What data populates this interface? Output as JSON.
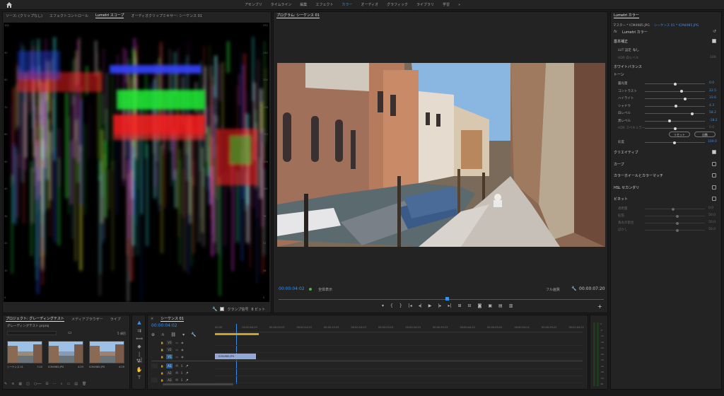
{
  "workspaces": {
    "items": [
      "アセンブリ",
      "タイムライン",
      "編集",
      "エフェクト",
      "カラー",
      "オーディオ",
      "グラフィック",
      "ライブラリ",
      "学習"
    ],
    "active_index": 4,
    "more": "»"
  },
  "scope_panel": {
    "tabs": [
      "ソース: (クリップなし)",
      "エフェクトコントロール",
      "Lumetri スコープ",
      "オーディオクリップミキサー: シーケンス 01"
    ],
    "active_tab": 2,
    "left_ticks": [
      "100",
      "90",
      "80",
      "70",
      "60",
      "50",
      "40",
      "30",
      "20",
      "10",
      "0"
    ],
    "right_ticks": [
      "255",
      "230",
      "204",
      "178",
      "153",
      "128",
      "102",
      "76",
      "51",
      "26",
      "0"
    ],
    "clamp_label": "クランプ信号",
    "bit_label": "8 ビット"
  },
  "program_panel": {
    "title": "プログラム: シーケンス 01",
    "timecode": "00:00:04:02",
    "fit_label": "全体表示",
    "quality_label": "フル画質",
    "duration": "00:00:07:20"
  },
  "lumetri": {
    "title": "Lumetri カラー",
    "master_label": "マスター * ICM4985.JPG",
    "sequence_label": "シーケンス 01 * ICM4985.JPG",
    "fx_label": "Lumetri カラー",
    "basic": "基本補正",
    "lut_label": "LUT 設定",
    "lut_value": "なし",
    "hdr_label": "HDR 白レベル",
    "hdr_value": "100",
    "white_balance": "ホワイトバランス",
    "tone": "トーン",
    "sliders": [
      {
        "label": "露光量",
        "value": "0.0",
        "pos": 0.5
      },
      {
        "label": "コントラスト",
        "value": "22.5",
        "pos": 0.61
      },
      {
        "label": "ハイライト",
        "value": "33.6",
        "pos": 0.67
      },
      {
        "label": "シャドウ",
        "value": "4.3",
        "pos": 0.52
      },
      {
        "label": "白レベル",
        "value": "58.2",
        "pos": 0.79
      },
      {
        "label": "黒レベル",
        "value": "-18.2",
        "pos": 0.41
      },
      {
        "label": "HDR スペキュラー",
        "value": "0.0",
        "pos": 0.5
      }
    ],
    "reset_button": "リセット",
    "auto_button": "自動",
    "saturation_label": "彩度",
    "saturation_value": "100.0",
    "sections": [
      {
        "label": "クリエイティブ",
        "checked": true
      },
      {
        "label": "カーブ",
        "checked": false
      },
      {
        "label": "カラーホイールとカラーマッチ",
        "checked": false
      },
      {
        "label": "HSL セカンダリ",
        "checked": false
      },
      {
        "label": "ビネット",
        "checked": false
      }
    ],
    "vignette": [
      {
        "label": "適用量",
        "value": "0.0"
      },
      {
        "label": "拡張",
        "value": "50.0"
      },
      {
        "label": "角丸の割合",
        "value": "50.0"
      },
      {
        "label": "ぼかし",
        "value": "50.0"
      }
    ]
  },
  "project_panel": {
    "tabs": [
      "プロジェクト: グレーディングテスト",
      "メディアブラウザー",
      "ライブ"
    ],
    "file_label": "グレーディングテスト.prproj",
    "count_label": "5 項目",
    "items": [
      {
        "name": "シーケンス 01",
        "dur": "7:20"
      },
      {
        "name": "ICM4983.JPG",
        "dur": "4:29"
      },
      {
        "name": "ICM4985.JPG",
        "dur": "4:29"
      }
    ]
  },
  "timeline": {
    "title": "シーケンス 01",
    "timecode": "00:00:04:02",
    "ruler": [
      "00:00",
      "00:00:04:23",
      "00:00:09:23",
      "00:00:14:23",
      "00:00:19:23",
      "00:00:24:23",
      "00:00:29:23",
      "00:00:34:23",
      "00:00:39:23",
      "00:00:44:22",
      "00:00:49:22",
      "00:00:54:22",
      "00:00:59:22",
      "00:01:04:22"
    ],
    "video_tracks": [
      "V3",
      "V2",
      "V1"
    ],
    "audio_tracks": [
      "A1",
      "A2",
      "A3"
    ],
    "clip_label": "ICM4985.JPG"
  },
  "meter": {
    "labels": [
      "0",
      "-6",
      "-12",
      "-18",
      "-24",
      "-30",
      "-36",
      "-42",
      "-48",
      "-54",
      "dB"
    ]
  }
}
